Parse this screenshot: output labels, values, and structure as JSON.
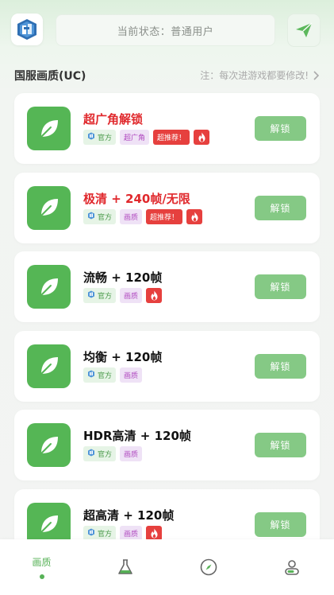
{
  "header": {
    "logo_icon": "app-logo-icon",
    "status_text": "当前状态：普通用户",
    "send_icon": "paper-plane-icon"
  },
  "section": {
    "title": "国服画质(UC)",
    "note": "注：每次进游戏都要修改!",
    "note_icon": "chevron-right-icon"
  },
  "colors": {
    "accent_green": "#55b655",
    "button_green": "#85c985",
    "title_red": "#e0282c",
    "tag_red": "#e6403e"
  },
  "cards": [
    {
      "title": "超广角解锁",
      "title_color": "red",
      "tags": [
        {
          "type": "official",
          "text": "官方"
        },
        {
          "type": "purple",
          "text": "超广角"
        },
        {
          "type": "red",
          "text": "超推荐！"
        },
        {
          "type": "fire",
          "text": ""
        }
      ],
      "button": "解锁"
    },
    {
      "title": "极清 + 240帧/无限",
      "title_color": "red",
      "tags": [
        {
          "type": "official",
          "text": "官方"
        },
        {
          "type": "purple",
          "text": "画质"
        },
        {
          "type": "red",
          "text": "超推荐！"
        },
        {
          "type": "fire",
          "text": ""
        }
      ],
      "button": "解锁"
    },
    {
      "title": "流畅 + 120帧",
      "title_color": "black",
      "tags": [
        {
          "type": "official",
          "text": "官方"
        },
        {
          "type": "purple",
          "text": "画质"
        },
        {
          "type": "fire",
          "text": ""
        }
      ],
      "button": "解锁"
    },
    {
      "title": "均衡 + 120帧",
      "title_color": "black",
      "tags": [
        {
          "type": "official",
          "text": "官方"
        },
        {
          "type": "purple",
          "text": "画质"
        }
      ],
      "button": "解锁"
    },
    {
      "title": "HDR高清 + 120帧",
      "title_color": "black",
      "tags": [
        {
          "type": "official",
          "text": "官方"
        },
        {
          "type": "purple",
          "text": "画质"
        }
      ],
      "button": "解锁"
    },
    {
      "title": "超高清 + 120帧",
      "title_color": "black",
      "tags": [
        {
          "type": "official",
          "text": "官方"
        },
        {
          "type": "purple",
          "text": "画质"
        },
        {
          "type": "fire",
          "text": ""
        }
      ],
      "button": "解锁"
    }
  ],
  "bottom_nav": [
    {
      "label": "画质",
      "active": true,
      "icon": "quality-tab-icon"
    },
    {
      "label": "",
      "active": false,
      "icon": "flask-icon"
    },
    {
      "label": "",
      "active": false,
      "icon": "compass-icon"
    },
    {
      "label": "",
      "active": false,
      "icon": "profile-icon"
    }
  ]
}
